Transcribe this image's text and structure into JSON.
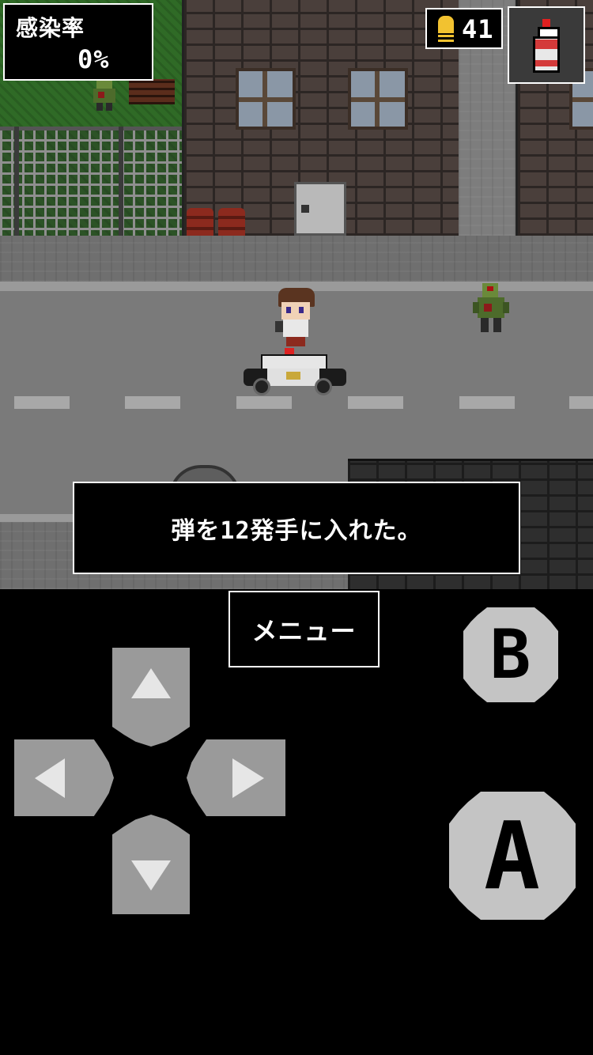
{
  "hud": {
    "infection_label": "感染率",
    "infection_value": "0%",
    "ammo_count": "41",
    "ammo_icon": "bullet-icon",
    "item_icon": "spray-can-icon"
  },
  "dialog": {
    "message": "弾を12発手に入れた。"
  },
  "controls": {
    "menu_label": "メニュー",
    "b_label": "B",
    "a_label": "A",
    "dpad_up_icon": "arrow-up-icon",
    "dpad_down_icon": "arrow-down-icon",
    "dpad_left_icon": "arrow-left-icon",
    "dpad_right_icon": "arrow-right-icon"
  },
  "colors": {
    "hud_background": "#000000",
    "hud_border": "#ffffff",
    "ammo_accent": "#f2c230",
    "button_gray": "#9a9a9a",
    "action_button": "#c4c4c4"
  }
}
